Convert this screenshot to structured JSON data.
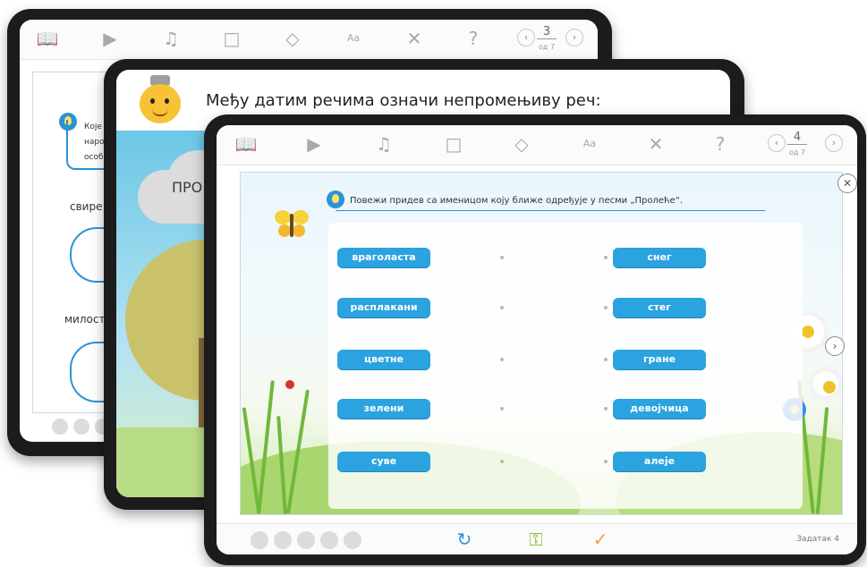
{
  "toolbar": {
    "book_icon": "book-icon",
    "video_icon": "video-icon",
    "music_icon": "music-note-icon",
    "cube_icon": "cube-icon",
    "eraser_icon": "eraser-icon",
    "font_icon": "font-icon",
    "tools_icon": "tools-icon",
    "help_icon": "help-icon",
    "help_glyph": "?",
    "font_glyph": "Aa"
  },
  "back_device": {
    "page_number": "3",
    "page_total": "од 7",
    "question_start_1": "Које р",
    "question_start_2": "народ",
    "question_start_3": "особе",
    "word_1": "свире",
    "word_2": "милости"
  },
  "middle_device": {
    "title": "Међу датим речима означи непромењиву реч:",
    "cloud_text": "ПРО"
  },
  "front_device": {
    "page_number": "4",
    "page_total": "од 7",
    "instruction": "Повежи придев са именицом коју ближе одређује у песми „Пролеће“.",
    "left_words": [
      "вraголаста",
      "расплакани",
      "цветне",
      "зелени",
      "суве"
    ],
    "right_words": [
      "снег",
      "стег",
      "гране",
      "девојчица",
      "алеје"
    ],
    "task_label": "Задатак 4",
    "footer_icons": [
      "reset-icon",
      "key-icon",
      "check-icon"
    ],
    "accent_color": "#2aa3e0"
  }
}
